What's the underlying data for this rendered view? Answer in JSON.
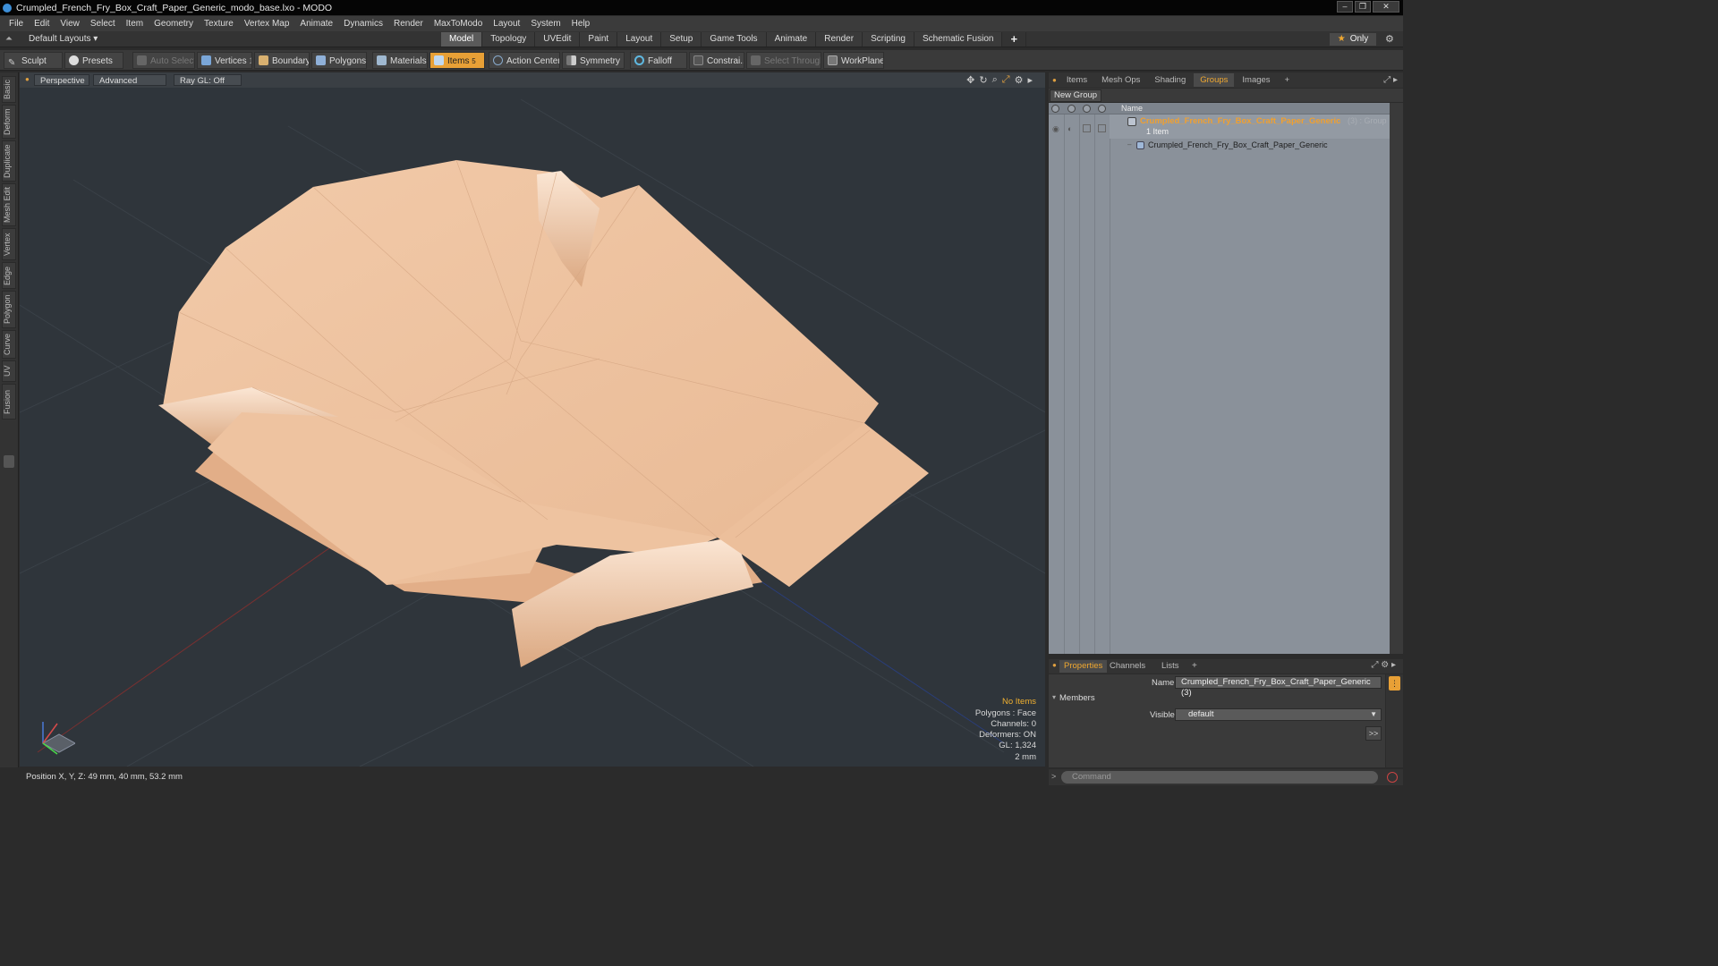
{
  "window": {
    "title": "Crumpled_French_Fry_Box_Craft_Paper_Generic_modo_base.lxo - MODO",
    "min": "–",
    "max": "❐",
    "close": "✕"
  },
  "menu": [
    "File",
    "Edit",
    "View",
    "Select",
    "Item",
    "Geometry",
    "Texture",
    "Vertex Map",
    "Animate",
    "Dynamics",
    "Render",
    "MaxToModo",
    "Layout",
    "System",
    "Help"
  ],
  "layout": {
    "dropdown": "Default Layouts ▾",
    "tabs": [
      "Model",
      "Topology",
      "UVEdit",
      "Paint",
      "Layout",
      "Setup",
      "Game Tools",
      "Animate",
      "Render",
      "Scripting",
      "Schematic Fusion"
    ],
    "active_tab": "Model",
    "add": "+",
    "only": "Only"
  },
  "toolbar": {
    "sculpt": "Sculpt",
    "presets": "Presets",
    "auto_select": "Auto Select",
    "vertices": "Vertices",
    "vertices_count": "1",
    "boundary": "Boundary",
    "polygons": "Polygons",
    "materials": "Materials",
    "items": "Items",
    "items_count": "5",
    "action_center": "Action Center",
    "symmetry": "Symmetry",
    "falloff": "Falloff",
    "constraints": "Constrai...",
    "select_through": "Select Through",
    "workplane": "WorkPlane"
  },
  "left_tabs": [
    "Basic",
    "Deform",
    "Duplicate",
    "Mesh Edit",
    "Vertex",
    "Edge",
    "Polygon",
    "Curve",
    "UV",
    "Fusion"
  ],
  "viewport": {
    "perspective": "Perspective",
    "advanced": "Advanced",
    "raygl": "Ray GL: Off",
    "hud": {
      "no_items": "No Items",
      "polygons": "Polygons : Face",
      "channels": "Channels: 0",
      "deformers": "Deformers: ON",
      "gl": "GL: 1,324",
      "scale": "2 mm"
    },
    "colors": {
      "paper_light": "#f3cfb0",
      "paper_mid": "#e6b896",
      "paper_dark": "#c99772",
      "bg": "#2f353b"
    }
  },
  "status": {
    "position": "Position X, Y, Z:  49 mm, 40 mm, 53.2 mm"
  },
  "right_panel": {
    "tabs": [
      "Items",
      "Mesh Ops",
      "Shading",
      "Groups",
      "Images"
    ],
    "active_tab": "Groups",
    "add": "+",
    "new_group": "New Group",
    "name_header": "Name",
    "group_name": "Crumpled_French_Fry_Box_Craft_Paper_Generic",
    "group_suffix": "(3) : Group",
    "group_count": "1 Item",
    "child_name": "Crumpled_French_Fry_Box_Craft_Paper_Generic"
  },
  "properties": {
    "tabs": [
      "Properties",
      "Channels",
      "Lists"
    ],
    "active_tab": "Properties",
    "add": "+",
    "name_label": "Name",
    "name_value": "Crumpled_French_Fry_Box_Craft_Paper_Generic (3)",
    "members": "Members",
    "visible_label": "Visible",
    "visible_value": "default",
    "more": ">>"
  },
  "command": {
    "placeholder": "Command"
  }
}
